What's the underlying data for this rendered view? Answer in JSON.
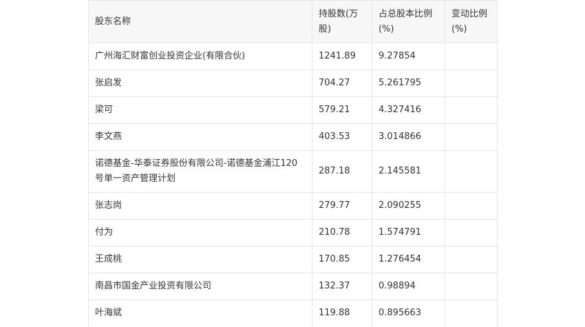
{
  "table": {
    "headers": [
      "股东名称",
      "持股数(万股)",
      "占总股本比例(%)",
      "变动比例(%)"
    ],
    "rows": [
      {
        "name": "广州海汇财富创业投资企业(有限合伙)",
        "shares": "1241.89",
        "ratio": "9.27854",
        "change": ""
      },
      {
        "name": "张启发",
        "shares": "704.27",
        "ratio": "5.261795",
        "change": ""
      },
      {
        "name": "梁可",
        "shares": "579.21",
        "ratio": "4.327416",
        "change": ""
      },
      {
        "name": "李文燕",
        "shares": "403.53",
        "ratio": "3.014866",
        "change": ""
      },
      {
        "name": "诺德基金-华泰证券股份有限公司-诺德基金浦江120号单一资产管理计划",
        "shares": "287.18",
        "ratio": "2.145581",
        "change": ""
      },
      {
        "name": "张志岗",
        "shares": "279.77",
        "ratio": "2.090255",
        "change": ""
      },
      {
        "name": "付为",
        "shares": "210.78",
        "ratio": "1.574791",
        "change": ""
      },
      {
        "name": "王成桃",
        "shares": "170.85",
        "ratio": "1.276454",
        "change": ""
      },
      {
        "name": "南昌市国金产业投资有限公司",
        "shares": "132.37",
        "ratio": "0.98894",
        "change": ""
      },
      {
        "name": "叶海斌",
        "shares": "119.88",
        "ratio": "0.895663",
        "change": ""
      }
    ]
  }
}
